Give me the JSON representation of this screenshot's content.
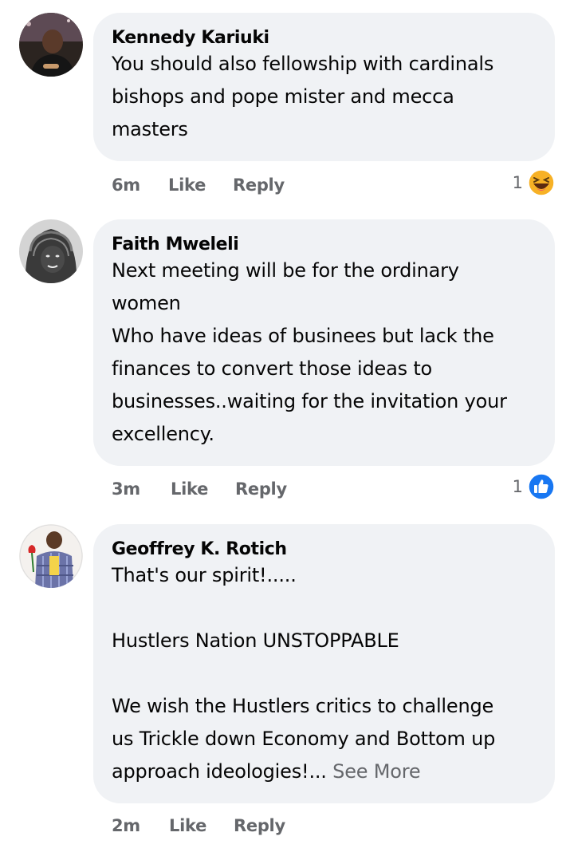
{
  "comments": [
    {
      "author": "Kennedy Kariuki",
      "text": "You should also fellowship with cardinals\nbishops and pope mister and mecca\nmasters",
      "time": "6m",
      "like_label": "Like",
      "reply_label": "Reply",
      "reaction_count": "1",
      "reaction_icon": "haha-reaction-icon"
    },
    {
      "author": "Faith Mweleli",
      "text": "Next meeting will be for the ordinary\nwomen\nWho have ideas of businees but lack the\nfinances to convert those ideas to\nbusinesses..waiting for the invitation your\nexcellency.",
      "time": "3m",
      "like_label": "Like",
      "reply_label": "Reply",
      "reaction_count": "1",
      "reaction_icon": "like-reaction-icon"
    },
    {
      "author": "Geoffrey K. Rotich",
      "text": "That's our spirit!.....\n\nHustlers Nation UNSTOPPABLE\n\nWe wish the Hustlers critics to challenge\nus Trickle down Economy and Bottom up\napproach ideologies!... ",
      "see_more": "See More",
      "time": "2m",
      "like_label": "Like",
      "reply_label": "Reply"
    }
  ],
  "colors": {
    "bubble": "#f0f2f5",
    "secondary_text": "#65676b",
    "like_blue": "#1877f2",
    "haha_yellow": "#f7b125"
  }
}
